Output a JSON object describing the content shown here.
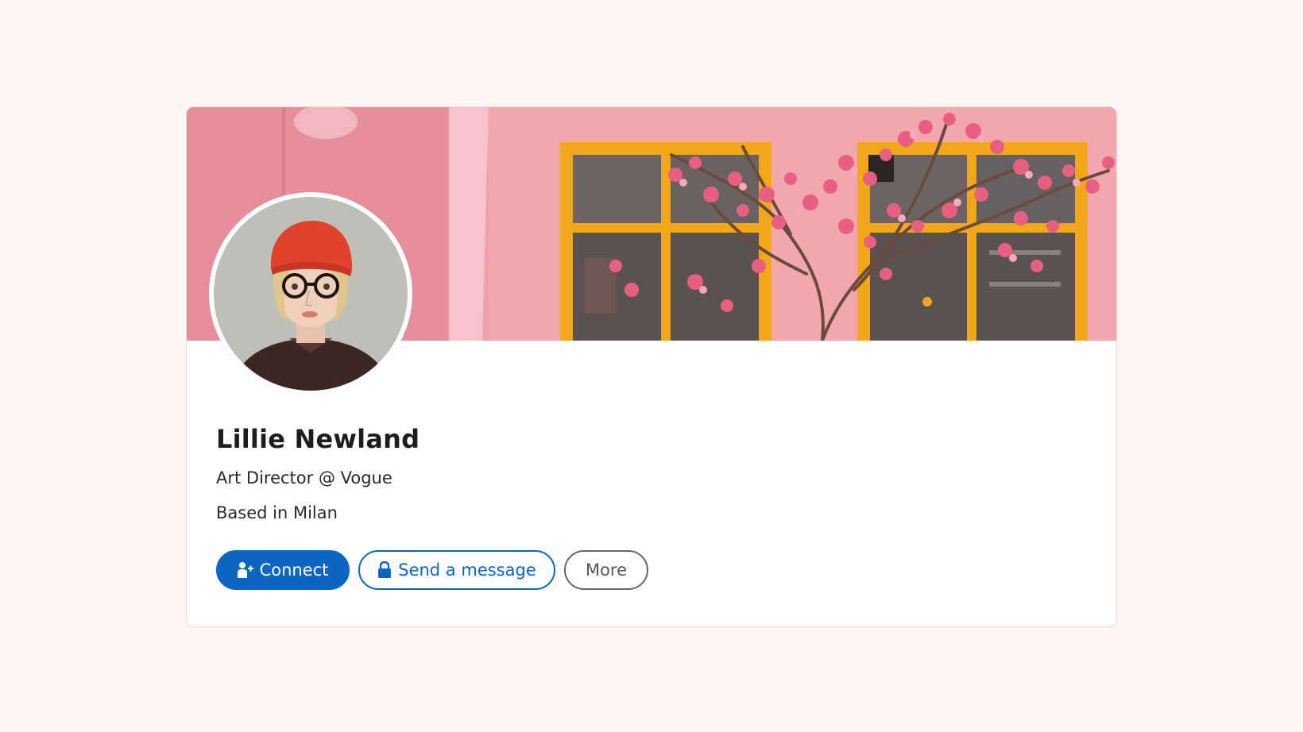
{
  "profile": {
    "name": "Lillie Newland",
    "headline": "Art Director @ Vogue",
    "location": "Based in Milan"
  },
  "actions": {
    "connect_label": "Connect",
    "message_label": "Send a message",
    "more_label": "More"
  },
  "icons": {
    "connect": "add-person-icon",
    "message": "lock-icon"
  },
  "colors": {
    "accent": "#0a66c2",
    "page_background": "#fdf6f2",
    "banner_wall": "#f0a3ad",
    "window_frame": "#f2a71a"
  }
}
